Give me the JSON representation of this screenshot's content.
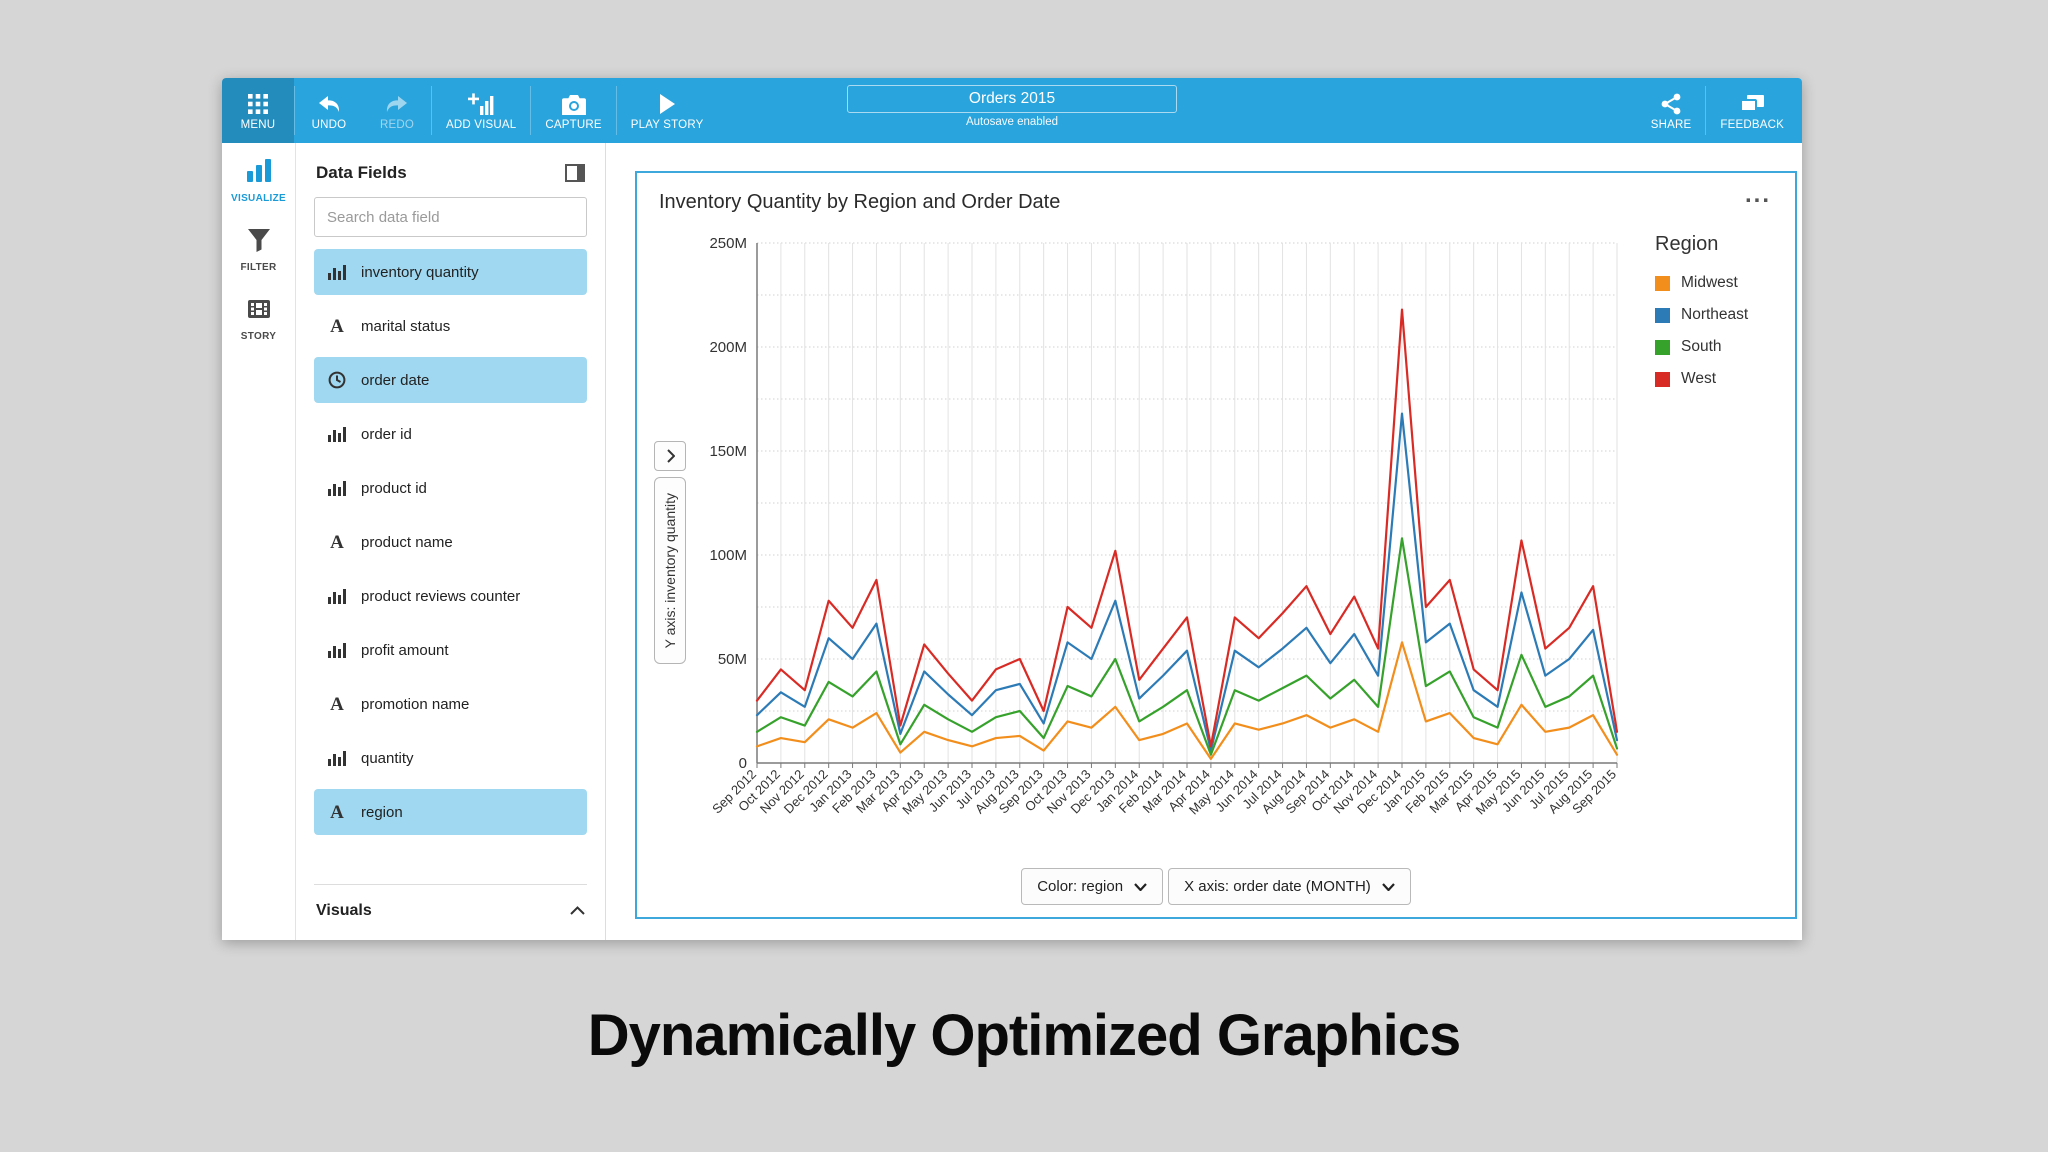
{
  "toolbar": {
    "left_buttons": [
      {
        "label": "MENU"
      },
      {
        "label": "UNDO"
      },
      {
        "label": "REDO"
      },
      {
        "label": "ADD VISUAL"
      },
      {
        "label": "CAPTURE"
      },
      {
        "label": "PLAY STORY"
      }
    ],
    "title": "Orders 2015",
    "subtitle": "Autosave enabled",
    "right_buttons": [
      {
        "label": "SHARE"
      },
      {
        "label": "FEEDBACK"
      }
    ]
  },
  "sidebar": {
    "items": [
      {
        "label": "VISUALIZE",
        "active": true
      },
      {
        "label": "FILTER",
        "active": false
      },
      {
        "label": "STORY",
        "active": false
      }
    ]
  },
  "data_panel": {
    "header": "Data Fields",
    "search_placeholder": "Search data field",
    "fields": [
      {
        "label": "inventory quantity",
        "type": "metric",
        "selected": true
      },
      {
        "label": "marital status",
        "type": "text",
        "selected": false
      },
      {
        "label": "order date",
        "type": "date",
        "selected": true
      },
      {
        "label": "order id",
        "type": "metric",
        "selected": false
      },
      {
        "label": "product id",
        "type": "metric",
        "selected": false
      },
      {
        "label": "product name",
        "type": "text",
        "selected": false
      },
      {
        "label": "product reviews counter",
        "type": "metric",
        "selected": false
      },
      {
        "label": "profit amount",
        "type": "metric",
        "selected": false
      },
      {
        "label": "promotion name",
        "type": "text",
        "selected": false
      },
      {
        "label": "quantity",
        "type": "metric",
        "selected": false
      },
      {
        "label": "region",
        "type": "text",
        "selected": true
      }
    ],
    "visuals_header": "Visuals"
  },
  "visual": {
    "title": "Inventory Quantity by Region and Order Date",
    "menu_label": "...",
    "legend_title": "Region",
    "y_axis_control": "Y axis: inventory quantity",
    "color_dropdown": "Color: region",
    "x_axis_dropdown": "X axis: order date (MONTH)"
  },
  "caption": "Dynamically Optimized Graphics",
  "colors": {
    "toolbar": "#2aa4dc",
    "accent": "#1a9ad7",
    "selected_field_bg": "#9fd8f0",
    "visual_border": "#3da8dc"
  },
  "chart_data": {
    "type": "line",
    "title": "Inventory Quantity by Region and Order Date",
    "xlabel": "order date (MONTH)",
    "ylabel": "inventory quantity",
    "ylim": [
      0,
      250
    ],
    "y_unit": "M",
    "yticks": [
      0,
      50,
      100,
      150,
      200,
      250
    ],
    "grid": true,
    "legend_position": "right",
    "x": [
      "Sep 2012",
      "Oct 2012",
      "Nov 2012",
      "Dec 2012",
      "Jan 2013",
      "Feb 2013",
      "Mar 2013",
      "Apr 2013",
      "May 2013",
      "Jun 2013",
      "Jul 2013",
      "Aug 2013",
      "Sep 2013",
      "Oct 2013",
      "Nov 2013",
      "Dec 2013",
      "Jan 2014",
      "Feb 2014",
      "Mar 2014",
      "Apr 2014",
      "May 2014",
      "Jun 2014",
      "Jul 2014",
      "Aug 2014",
      "Sep 2014",
      "Oct 2014",
      "Nov 2014",
      "Dec 2014",
      "Jan 2015",
      "Feb 2015",
      "Mar 2015",
      "Apr 2015",
      "May 2015",
      "Jun 2015",
      "Jul 2015",
      "Aug 2015",
      "Sep 2015"
    ],
    "series": [
      {
        "name": "Midwest",
        "color": "#f28e1c",
        "values": [
          8,
          12,
          10,
          21,
          17,
          24,
          5,
          15,
          11,
          8,
          12,
          13,
          6,
          20,
          17,
          27,
          11,
          14,
          19,
          2,
          19,
          16,
          19,
          23,
          17,
          21,
          15,
          58,
          20,
          24,
          12,
          9,
          28,
          15,
          17,
          23,
          4
        ]
      },
      {
        "name": "Northeast",
        "color": "#2d7bb6",
        "values": [
          23,
          34,
          27,
          60,
          50,
          67,
          14,
          44,
          33,
          23,
          35,
          38,
          19,
          58,
          50,
          78,
          31,
          42,
          54,
          6,
          54,
          46,
          55,
          65,
          48,
          62,
          42,
          168,
          58,
          67,
          35,
          27,
          82,
          42,
          50,
          64,
          11
        ]
      },
      {
        "name": "South",
        "color": "#36a22c",
        "values": [
          15,
          22,
          18,
          39,
          32,
          44,
          9,
          28,
          21,
          15,
          22,
          25,
          12,
          37,
          32,
          50,
          20,
          27,
          35,
          4,
          35,
          30,
          36,
          42,
          31,
          40,
          27,
          108,
          37,
          44,
          22,
          17,
          52,
          27,
          32,
          42,
          7
        ]
      },
      {
        "name": "West",
        "color": "#d92b25",
        "values": [
          30,
          45,
          35,
          78,
          65,
          88,
          18,
          57,
          43,
          30,
          45,
          50,
          25,
          75,
          65,
          102,
          40,
          55,
          70,
          8,
          70,
          60,
          72,
          85,
          62,
          80,
          55,
          218,
          75,
          88,
          45,
          35,
          107,
          55,
          65,
          85,
          15
        ]
      }
    ]
  }
}
